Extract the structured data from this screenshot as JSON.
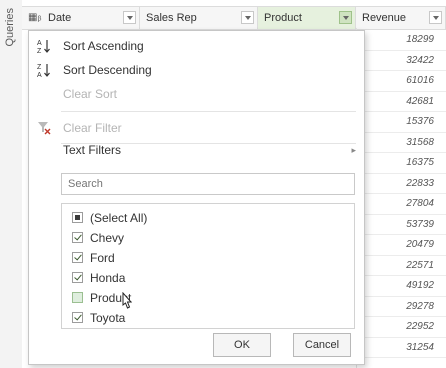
{
  "sidebar": {
    "label": "Queries"
  },
  "columns": [
    {
      "type_glyph": "▦ᵦ",
      "name": "Date"
    },
    {
      "type_glyph": "",
      "name": "Sales Rep"
    },
    {
      "type_glyph": "",
      "name": "Product"
    },
    {
      "type_glyph": "",
      "name": "Revenue"
    }
  ],
  "revenue_values": [
    "18299",
    "32422",
    "61016",
    "42681",
    "15376",
    "31568",
    "16375",
    "22833",
    "27804",
    "53739",
    "20479",
    "22571",
    "49192",
    "29278",
    "22952",
    "31254"
  ],
  "menu": {
    "sort_ascending": "Sort Ascending",
    "sort_descending": "Sort Descending",
    "clear_sort": "Clear Sort",
    "clear_filter": "Clear Filter",
    "text_filters": "Text Filters"
  },
  "search": {
    "placeholder": "Search"
  },
  "filter_list": [
    {
      "label": "(Select All)",
      "state": "partial"
    },
    {
      "label": "Chevy",
      "state": "checked"
    },
    {
      "label": "Ford",
      "state": "checked"
    },
    {
      "label": "Honda",
      "state": "checked"
    },
    {
      "label": "Product",
      "state": "unchecked-hover"
    },
    {
      "label": "Toyota",
      "state": "checked"
    }
  ],
  "buttons": {
    "ok": "OK",
    "cancel": "Cancel"
  },
  "colors": {
    "active_header": "#e6f1de",
    "accent_green": "#3b5a2e",
    "clear_filter_icon": "#c0392b"
  }
}
